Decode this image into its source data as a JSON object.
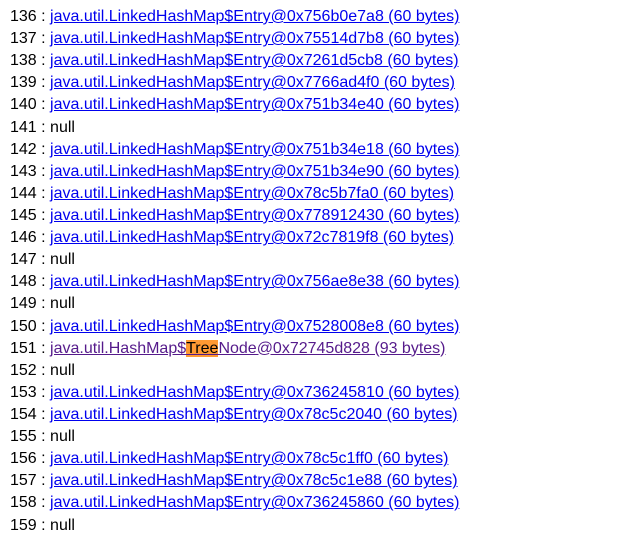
{
  "separator": " : ",
  "null_text": "null",
  "class_prefix": "java.util.LinkedHashMap$Entry@",
  "hashmap_prefix": "java.util.HashMap$",
  "highlight_word": "Tree",
  "treenode_suffix_prefix": "Node@",
  "size_prefix": "  (",
  "size_suffix": " bytes)",
  "entries": [
    {
      "index": "136",
      "type": "link",
      "addr": "0x756b0e7a8",
      "size": "60"
    },
    {
      "index": "137",
      "type": "link",
      "addr": "0x75514d7b8",
      "size": "60"
    },
    {
      "index": "138",
      "type": "link",
      "addr": "0x7261d5cb8",
      "size": "60"
    },
    {
      "index": "139",
      "type": "link",
      "addr": "0x7766ad4f0",
      "size": "60"
    },
    {
      "index": "140",
      "type": "link",
      "addr": "0x751b34e40",
      "size": "60"
    },
    {
      "index": "141",
      "type": "null"
    },
    {
      "index": "142",
      "type": "link",
      "addr": "0x751b34e18",
      "size": "60"
    },
    {
      "index": "143",
      "type": "link",
      "addr": "0x751b34e90",
      "size": "60"
    },
    {
      "index": "144",
      "type": "link",
      "addr": "0x78c5b7fa0",
      "size": "60"
    },
    {
      "index": "145",
      "type": "link",
      "addr": "0x778912430",
      "size": "60"
    },
    {
      "index": "146",
      "type": "link",
      "addr": "0x72c7819f8",
      "size": "60"
    },
    {
      "index": "147",
      "type": "null"
    },
    {
      "index": "148",
      "type": "link",
      "addr": "0x756ae8e38",
      "size": "60"
    },
    {
      "index": "149",
      "type": "null"
    },
    {
      "index": "150",
      "type": "link",
      "addr": "0x7528008e8",
      "size": "60"
    },
    {
      "index": "151",
      "type": "treenode",
      "addr": "0x72745d828",
      "size": "93"
    },
    {
      "index": "152",
      "type": "null"
    },
    {
      "index": "153",
      "type": "link",
      "addr": "0x736245810",
      "size": "60"
    },
    {
      "index": "154",
      "type": "link",
      "addr": "0x78c5c2040",
      "size": "60"
    },
    {
      "index": "155",
      "type": "null"
    },
    {
      "index": "156",
      "type": "link",
      "addr": "0x78c5c1ff0",
      "size": "60"
    },
    {
      "index": "157",
      "type": "link",
      "addr": "0x78c5c1e88",
      "size": "60"
    },
    {
      "index": "158",
      "type": "link",
      "addr": "0x736245860",
      "size": "60"
    },
    {
      "index": "159",
      "type": "null"
    }
  ]
}
